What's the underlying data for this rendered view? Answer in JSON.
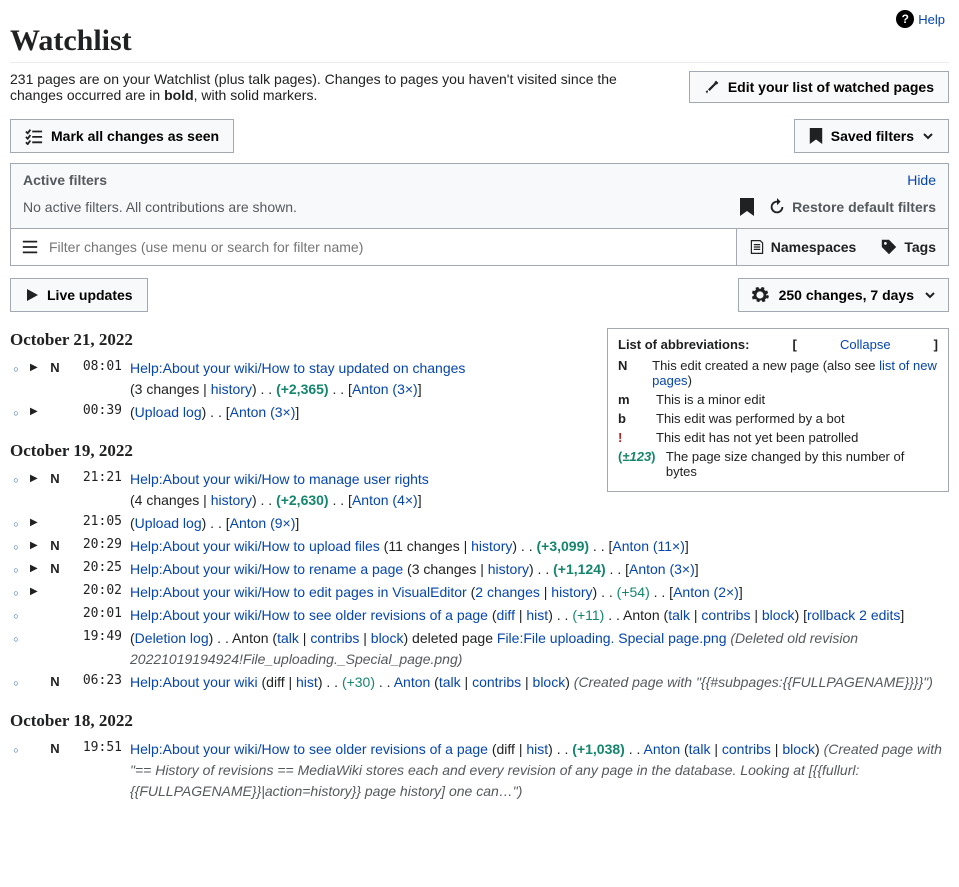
{
  "help": {
    "label": "Help"
  },
  "page_title": "Watchlist",
  "sub_pre": "231 pages are on your Watchlist (plus talk pages). Changes to pages you haven't visited since the changes occurred are in ",
  "sub_bold": "bold",
  "sub_post": ", with solid markers.",
  "edit_watched_btn": "Edit your list of watched pages",
  "mark_seen_btn": "Mark all changes as seen",
  "saved_filters_btn": "Saved filters",
  "active_filters": {
    "title": "Active filters",
    "hide": "Hide",
    "body": "No active filters. All contributions are shown.",
    "restore": "Restore default filters"
  },
  "filter_input_placeholder": "Filter changes (use menu or search for filter name)",
  "namespaces_label": "Namespaces",
  "tags_label": "Tags",
  "live_updates_btn": "Live updates",
  "count_days": "250 changes, 7 days",
  "legend": {
    "title": "List of abbreviations:",
    "collapse": "Collapse",
    "n_desc_pre": "This edit created a new page (also see ",
    "n_desc_link": "list of new pages",
    "n_desc_post": ")",
    "m_desc": "This is a minor edit",
    "b_desc": "This edit was performed by a bot",
    "ex_desc": "This edit has not yet been patrolled",
    "size_sym": "±123",
    "size_desc": "The page size changed by this number of bytes"
  },
  "dates": {
    "d1": "October 21, 2022",
    "d2": "October 19, 2022",
    "d3": "October 18, 2022"
  },
  "common": {
    "history": "history",
    "upload_log": "Upload log",
    "diff": "diff",
    "hist": "hist",
    "talk": "talk",
    "contribs": "contribs",
    "block": "block",
    "deletion_log": "Deletion log",
    "changes_word": "changes",
    "anton": "Anton"
  },
  "e1": {
    "time": "08:01",
    "title": "Help:About your wiki/How to stay updated on changes",
    "chg": "3 changes",
    "size": "(+2,365)",
    "who": "Anton (3×)"
  },
  "e2": {
    "time": "00:39",
    "who": "Anton (3×)"
  },
  "e3": {
    "time": "21:21",
    "title": "Help:About your wiki/How to manage user rights",
    "chg": "4 changes",
    "size": "(+2,630)",
    "who": "Anton (4×)"
  },
  "e4": {
    "time": "21:05",
    "who": "Anton (9×)"
  },
  "e5": {
    "time": "20:29",
    "title": "Help:About your wiki/How to upload files",
    "chg": "11 changes",
    "size": "(+3,099)",
    "who": "Anton (11×)"
  },
  "e6": {
    "time": "20:25",
    "title": "Help:About your wiki/How to rename a page",
    "chg": "3 changes",
    "size": "(+1,124)",
    "who": "Anton (3×)"
  },
  "e7": {
    "time": "20:02",
    "title": "Help:About your wiki/How to edit pages in VisualEditor",
    "chg": "2 changes",
    "size": "(+54)",
    "who": "Anton (2×)"
  },
  "e8": {
    "time": "20:01",
    "title": "Help:About your wiki/How to see older revisions of a page",
    "size": "(+11)",
    "rollback": "rollback 2 edits"
  },
  "e9": {
    "time": "19:49",
    "mid": "deleted page",
    "file": "File:File uploading. Special page.png",
    "summary": "(Deleted old revision 20221019194924!File_uploading._Special_page.png)"
  },
  "e10": {
    "time": "06:23",
    "title": "Help:About your wiki",
    "size": "(+30)",
    "summary": "(Created page with \"{{#subpages:{{FULLPAGENAME}}}}\")"
  },
  "e11": {
    "time": "19:51",
    "title": "Help:About your wiki/How to see older revisions of a page",
    "size": "(+1,038)",
    "summary": "(Created page with \"== History of revisions == MediaWiki stores each and every revision of any page in the database. Looking at [{{fullurl: {{FULLPAGENAME}}|action=history}} page history] one can…\")"
  }
}
